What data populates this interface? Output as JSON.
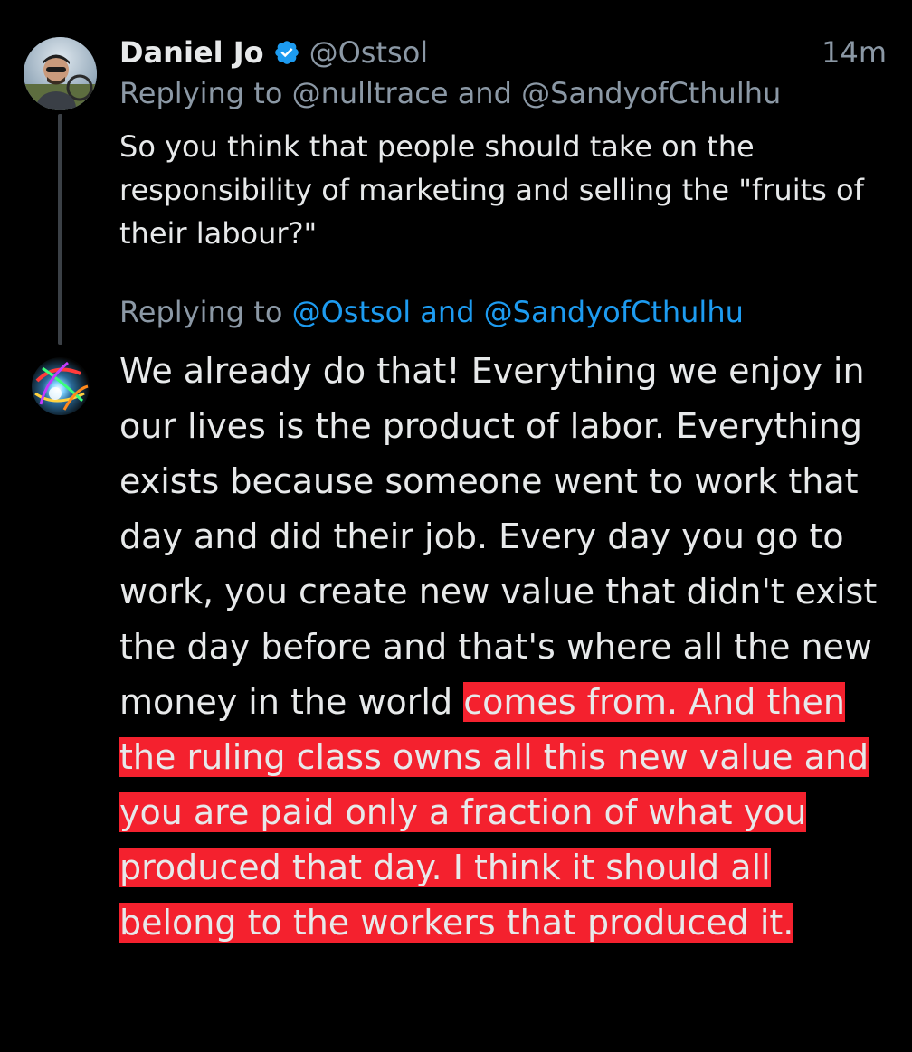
{
  "parent_tweet": {
    "display_name": "Daniel Jo",
    "handle": "@Ostsol",
    "timestamp": "14m",
    "replying_to": "Replying to @nulltrace and @SandyofCthulhu",
    "text": "So you think that people should take on the responsibility of marketing and selling the \"fruits of their labour?\""
  },
  "reply_compose": {
    "replying_to_prefix": "Replying to ",
    "replying_to_mentions": "@Ostsol and @SandyofCthulhu",
    "text_plain": "We already do that! Everything we enjoy in our lives is the product of labor. Everything exists because someone went to work that day and did their job. Every day you go to work, you create new value that didn't exist the day before and that's where all the new money in the world",
    "text_highlighted": "comes from. And then the ruling class owns all this new value and you are paid only a fraction of what you produced that day. I think it should all belong to the workers that produced it."
  },
  "colors": {
    "background": "#000000",
    "primary_text": "#e7e9ea",
    "secondary_text": "#8b98a5",
    "link": "#1d9bf0",
    "verified_badge": "#1d9bf0",
    "highlight": "#f4212e"
  },
  "icons": {
    "verified": "verified-badge-icon",
    "avatar_parent": "user-avatar",
    "avatar_reply": "user-avatar"
  }
}
